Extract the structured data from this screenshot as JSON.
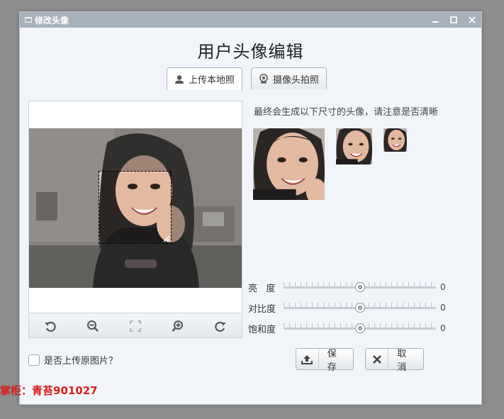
{
  "window": {
    "title": "修改头像"
  },
  "heading": "用户头像编辑",
  "tabs": [
    {
      "label": "上传本地照",
      "icon": "user-icon",
      "active": true
    },
    {
      "label": "摄像头拍照",
      "icon": "webcam-icon",
      "active": false
    }
  ],
  "preview": {
    "hint": "最终会生成以下尺寸的头像，请注意是否清晰"
  },
  "toolbar": {
    "tools": [
      "rotate-left-icon",
      "zoom-out-icon",
      "fit-icon",
      "zoom-in-icon",
      "rotate-right-icon"
    ]
  },
  "adjustments": [
    {
      "label": "亮   度",
      "value": "0",
      "position": 0.5
    },
    {
      "label": "对比度",
      "value": "0",
      "position": 0.5
    },
    {
      "label": "饱和度",
      "value": "0",
      "position": 0.5
    }
  ],
  "options": {
    "upload_original_label": "是否上传原图片？",
    "upload_original_checked": false
  },
  "actions": {
    "save_label": "保存",
    "cancel_label": "取消"
  },
  "watermark": "掌柜：青苔901027",
  "colors": {
    "titlebar": "#a8b2bd",
    "window_bg": "#f1f5f9",
    "watermark": "#d8201d"
  }
}
